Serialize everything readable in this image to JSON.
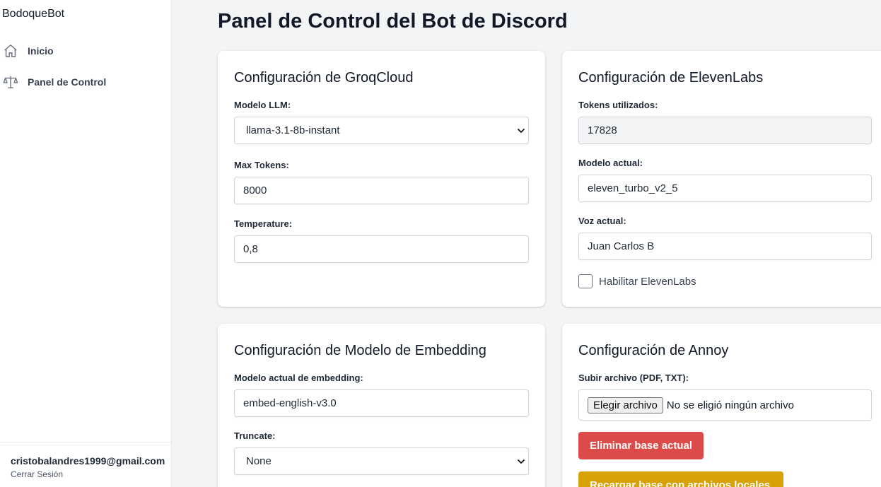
{
  "sidebar": {
    "brand": "BodoqueBot",
    "items": [
      {
        "label": "Inicio",
        "icon": "home-icon"
      },
      {
        "label": "Panel de Control",
        "icon": "scale-icon"
      }
    ],
    "user_email": "cristobalandres1999@gmail.com",
    "logout_label": "Cerrar Sesión"
  },
  "main": {
    "title": "Panel de Control del Bot de Discord",
    "groq": {
      "title": "Configuración de GroqCloud",
      "model_label": "Modelo LLM:",
      "model_value": "llama-3.1-8b-instant",
      "max_tokens_label": "Max Tokens:",
      "max_tokens_value": "8000",
      "temperature_label": "Temperature:",
      "temperature_value": "0,8"
    },
    "eleven": {
      "title": "Configuración de ElevenLabs",
      "tokens_label": "Tokens utilizados:",
      "tokens_value": "17828",
      "model_label": "Modelo actual:",
      "model_value": "eleven_turbo_v2_5",
      "voice_label": "Voz actual:",
      "voice_value": "Juan Carlos B",
      "enable_label": "Habilitar ElevenLabs"
    },
    "embedding": {
      "title": "Configuración de Modelo de Embedding",
      "model_label": "Modelo actual de embedding:",
      "model_value": "embed-english-v3.0",
      "truncate_label": "Truncate:",
      "truncate_value": "None"
    },
    "annoy": {
      "title": "Configuración de Annoy",
      "upload_label": "Subir archivo (PDF, TXT):",
      "choose_file_label": "Elegir archivo",
      "no_file_label": "No se eligió ningún archivo",
      "delete_button": "Eliminar base actual",
      "reload_button": "Recargar base con archivos locales"
    }
  },
  "colors": {
    "danger": "#dc4a4a",
    "warning": "#d8a207",
    "background": "#f3f4f6"
  }
}
